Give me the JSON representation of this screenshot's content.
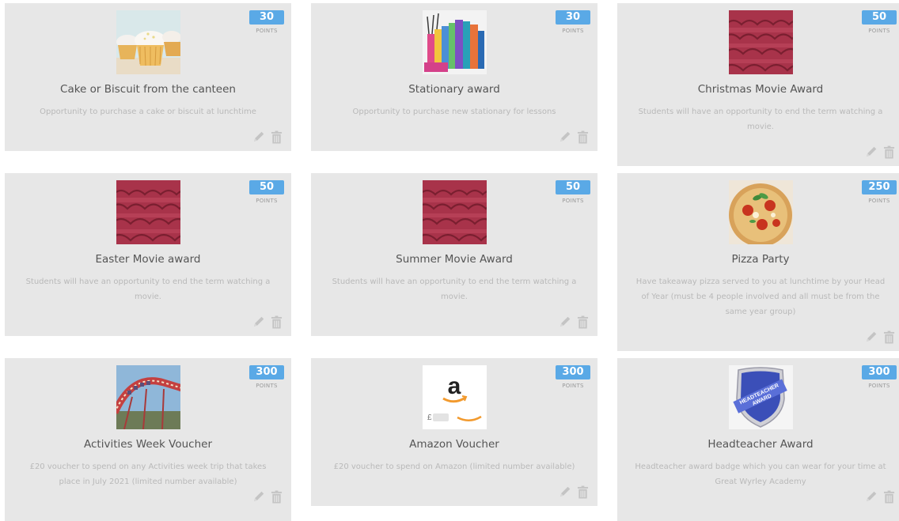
{
  "points_label": "POINTS",
  "rewards": [
    {
      "title": "Cake or Biscuit from the canteen",
      "points": "30",
      "description": "Opportunity to purchase a cake or biscuit at lunchtime",
      "image_icon": "cupcake-image"
    },
    {
      "title": "Stationary award",
      "points": "30",
      "description": "Opportunity to purchase new stationary for lessons",
      "image_icon": "stationery-image"
    },
    {
      "title": "Christmas Movie Award",
      "points": "50",
      "description": "Students will have an opportunity to end the term watching a movie.",
      "image_icon": "cinema-seats-image"
    },
    {
      "title": "Easter Movie award",
      "points": "50",
      "description": "Students will have an opportunity to end the term watching a movie.",
      "image_icon": "cinema-seats-image"
    },
    {
      "title": "Summer Movie Award",
      "points": "50",
      "description": "Students will have an opportunity to end the term watching a movie.",
      "image_icon": "cinema-seats-image"
    },
    {
      "title": "Pizza Party",
      "points": "250",
      "description": "Have takeaway pizza served to you at lunchtime by your Head of Year (must be 4 people involved and all must be from the same year group)",
      "image_icon": "pizza-image"
    },
    {
      "title": "Activities Week Voucher",
      "points": "300",
      "description": "£20 voucher to spend on any Activities week trip that takes place in July 2021 (limited number available)",
      "image_icon": "rollercoaster-image"
    },
    {
      "title": "Amazon Voucher",
      "points": "300",
      "description": "£20 voucher to spend on Amazon (limited number available)",
      "image_icon": "amazon-gift-card-image"
    },
    {
      "title": "Headteacher Award",
      "points": "300",
      "description": "Headteacher award badge which you can wear for your time at Great Wyrley Academy",
      "image_icon": "headteacher-badge-image"
    }
  ],
  "amazon_card": {
    "logo_letter": "a",
    "currency": "£"
  },
  "badge": {
    "line1": "HEADTEACHER",
    "line2": "AWARD"
  },
  "colors": {
    "points_badge": "#5aa9e6",
    "card_background": "#e7e7e7",
    "action_icon": "#c4c4c4"
  }
}
